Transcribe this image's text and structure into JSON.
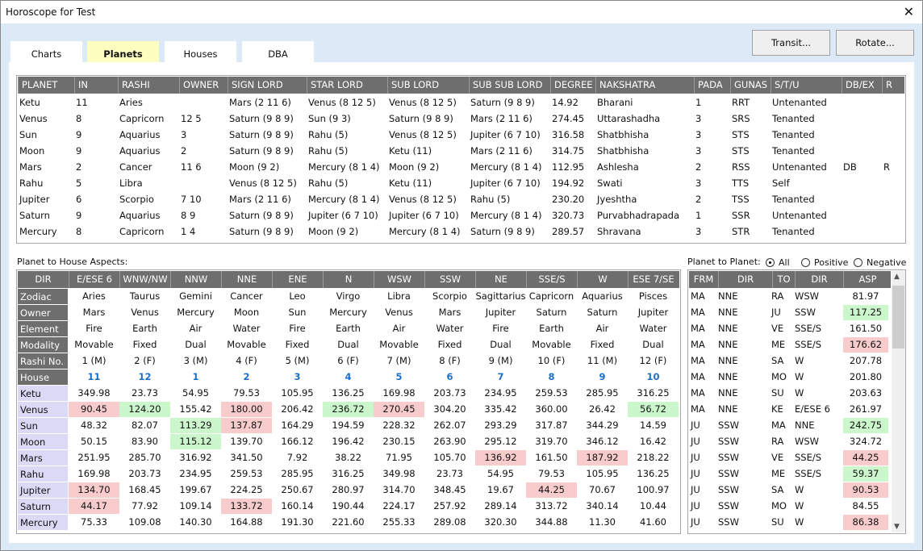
{
  "window": {
    "title": "Horoscope for Test"
  },
  "tabs": [
    {
      "label": "Charts"
    },
    {
      "label": "Planets",
      "active": true
    },
    {
      "label": "Houses"
    },
    {
      "label": "DBA"
    }
  ],
  "buttons": {
    "transit": "Transit...",
    "rotate": "Rotate..."
  },
  "colors": {
    "header": "#6e6e6e",
    "negative": "#f8cccc",
    "positive": "#ccf7cc",
    "planet_label": "#dcd9f6",
    "house_number": "#1c6fc4",
    "active_tab": "#fefec0"
  },
  "planets_table": {
    "columns": [
      "PLANET",
      "IN",
      "RASHI",
      "OWNER",
      "SIGN LORD",
      "STAR LORD",
      "SUB LORD",
      "SUB SUB LORD",
      "DEGREE",
      "NAKSHATRA",
      "PADA",
      "GUNAS",
      "S/T/U",
      "DB/EX",
      "R"
    ],
    "rows": [
      [
        "Ketu",
        "11",
        "Aries",
        "",
        "Mars (2 11 6)",
        "Venus (8 12 5)",
        "Venus (8 12 5)",
        "Saturn (9 8 9)",
        "14.92",
        "Bharani",
        "1",
        "RRT",
        "Untenanted",
        "",
        ""
      ],
      [
        "Venus",
        "8",
        "Capricorn",
        "12 5",
        "Saturn (9 8 9)",
        "Sun (9 3)",
        "Saturn (9 8 9)",
        "Mars (2 11 6)",
        "274.45",
        "Uttarashadha",
        "3",
        "SRS",
        "Tenanted",
        "",
        ""
      ],
      [
        "Sun",
        "9",
        "Aquarius",
        "3",
        "Saturn (9 8 9)",
        "Rahu (5)",
        "Venus (8 12 5)",
        "Jupiter (6 7 10)",
        "316.58",
        "Shatbhisha",
        "3",
        "STS",
        "Tenanted",
        "",
        ""
      ],
      [
        "Moon",
        "9",
        "Aquarius",
        "2",
        "Saturn (9 8 9)",
        "Rahu (5)",
        "Ketu (11)",
        "Mars (2 11 6)",
        "314.75",
        "Shatbhisha",
        "3",
        "STS",
        "Tenanted",
        "",
        ""
      ],
      [
        "Mars",
        "2",
        "Cancer",
        "11 6",
        "Moon (9 2)",
        "Mercury (8 1 4)",
        "Moon (9 2)",
        "Mercury (8 1 4)",
        "112.95",
        "Ashlesha",
        "2",
        "RSS",
        "Untenanted",
        "DB",
        "R"
      ],
      [
        "Rahu",
        "5",
        "Libra",
        "",
        "Venus (8 12 5)",
        "Rahu (5)",
        "Ketu (11)",
        "Jupiter (6 7 10)",
        "194.92",
        "Swati",
        "3",
        "TTS",
        "Self",
        "",
        ""
      ],
      [
        "Jupiter",
        "6",
        "Scorpio",
        "7 10",
        "Mars (2 11 6)",
        "Mercury (8 1 4)",
        "Venus (8 12 5)",
        "Rahu (5)",
        "230.20",
        "Jyeshtha",
        "2",
        "TSS",
        "Tenanted",
        "",
        ""
      ],
      [
        "Saturn",
        "9",
        "Aquarius",
        "8 9",
        "Saturn (9 8 9)",
        "Jupiter (6 7 10)",
        "Jupiter (6 7 10)",
        "Mercury (8 1 4)",
        "320.73",
        "Purvabhadrapada",
        "1",
        "SSR",
        "Untenanted",
        "",
        ""
      ],
      [
        "Mercury",
        "8",
        "Capricorn",
        "1 4",
        "Saturn (9 8 9)",
        "Moon (9 2)",
        "Mercury (8 1 4)",
        "Saturn (9 8 9)",
        "289.57",
        "Shravana",
        "3",
        "STR",
        "Tenanted",
        "",
        ""
      ]
    ]
  },
  "house_aspects": {
    "label": "Planet to House Aspects:",
    "corner": "DIR",
    "directions": [
      "E/ESE 6",
      "WNW/NW",
      "NNW",
      "NNE",
      "ENE",
      "N",
      "WSW",
      "SSW",
      "NE",
      "SSE/S",
      "W",
      "ESE 7/SE"
    ],
    "info_rows": [
      {
        "label": "Zodiac",
        "values": [
          "Aries",
          "Taurus",
          "Gemini",
          "Cancer",
          "Leo",
          "Virgo",
          "Libra",
          "Scorpio",
          "Sagittarius",
          "Capricorn",
          "Aquarius",
          "Pisces"
        ]
      },
      {
        "label": "Owner",
        "values": [
          "Mars",
          "Venus",
          "Mercury",
          "Moon",
          "Sun",
          "Mercury",
          "Venus",
          "Mars",
          "Jupiter",
          "Saturn",
          "Saturn",
          "Jupiter"
        ]
      },
      {
        "label": "Element",
        "values": [
          "Fire",
          "Earth",
          "Air",
          "Water",
          "Fire",
          "Earth",
          "Air",
          "Water",
          "Fire",
          "Earth",
          "Air",
          "Water"
        ]
      },
      {
        "label": "Modality",
        "values": [
          "Movable",
          "Fixed",
          "Dual",
          "Movable",
          "Fixed",
          "Dual",
          "Movable",
          "Fixed",
          "Dual",
          "Movable",
          "Fixed",
          "Dual"
        ]
      },
      {
        "label": "Rashi No.",
        "values": [
          "1 (M)",
          "2 (F)",
          "3 (M)",
          "4 (F)",
          "5 (M)",
          "6 (F)",
          "7 (M)",
          "8 (F)",
          "9 (M)",
          "10 (F)",
          "11 (M)",
          "12 (F)"
        ]
      },
      {
        "label": "House",
        "values": [
          "11",
          "12",
          "1",
          "2",
          "3",
          "4",
          "5",
          "6",
          "7",
          "8",
          "9",
          "10"
        ],
        "house": true
      }
    ],
    "planet_rows": [
      {
        "label": "Ketu",
        "values": [
          "349.98",
          "23.73",
          "54.95",
          "79.53",
          "105.95",
          "136.25",
          "169.98",
          "203.73",
          "234.95",
          "259.53",
          "285.95",
          "316.25"
        ],
        "marks": [
          "",
          "",
          "",
          "",
          "",
          "",
          "",
          "",
          "",
          "",
          "",
          ""
        ]
      },
      {
        "label": "Venus",
        "values": [
          "90.45",
          "124.20",
          "155.42",
          "180.00",
          "206.42",
          "236.72",
          "270.45",
          "304.20",
          "335.42",
          "360.00",
          "26.42",
          "56.72"
        ],
        "marks": [
          "neg",
          "pos",
          "",
          "neg",
          "",
          "pos",
          "neg",
          "",
          "",
          "",
          "",
          "pos"
        ]
      },
      {
        "label": "Sun",
        "values": [
          "48.32",
          "82.07",
          "113.29",
          "137.87",
          "164.29",
          "194.59",
          "228.32",
          "262.07",
          "293.29",
          "317.87",
          "344.29",
          "14.59"
        ],
        "marks": [
          "",
          "",
          "pos",
          "neg",
          "",
          "",
          "",
          "",
          "",
          "",
          "",
          ""
        ]
      },
      {
        "label": "Moon",
        "values": [
          "50.15",
          "83.90",
          "115.12",
          "139.70",
          "166.12",
          "196.42",
          "230.15",
          "263.90",
          "295.12",
          "319.70",
          "346.12",
          "16.42"
        ],
        "marks": [
          "",
          "",
          "pos",
          "",
          "",
          "",
          "",
          "",
          "",
          "",
          "",
          ""
        ]
      },
      {
        "label": "Mars",
        "values": [
          "251.95",
          "285.70",
          "316.92",
          "341.50",
          "7.92",
          "38.22",
          "71.95",
          "105.70",
          "136.92",
          "161.50",
          "187.92",
          "218.22"
        ],
        "marks": [
          "",
          "",
          "",
          "",
          "",
          "",
          "",
          "",
          "neg",
          "",
          "neg",
          ""
        ]
      },
      {
        "label": "Rahu",
        "values": [
          "169.98",
          "203.73",
          "234.95",
          "259.53",
          "285.95",
          "316.25",
          "349.98",
          "23.73",
          "54.95",
          "79.53",
          "105.95",
          "136.25"
        ],
        "marks": [
          "",
          "",
          "",
          "",
          "",
          "",
          "",
          "",
          "",
          "",
          "",
          ""
        ]
      },
      {
        "label": "Jupiter",
        "values": [
          "134.70",
          "168.45",
          "199.67",
          "224.25",
          "250.67",
          "280.97",
          "314.70",
          "348.45",
          "19.67",
          "44.25",
          "70.67",
          "100.97"
        ],
        "marks": [
          "neg",
          "",
          "",
          "",
          "",
          "",
          "",
          "",
          "",
          "neg",
          "",
          ""
        ]
      },
      {
        "label": "Saturn",
        "values": [
          "44.17",
          "77.92",
          "109.14",
          "133.72",
          "160.14",
          "190.44",
          "224.17",
          "257.92",
          "289.14",
          "313.72",
          "340.14",
          "10.44"
        ],
        "marks": [
          "neg",
          "",
          "",
          "neg",
          "",
          "",
          "",
          "",
          "",
          "",
          "",
          ""
        ]
      },
      {
        "label": "Mercury",
        "values": [
          "75.33",
          "109.08",
          "140.30",
          "164.88",
          "191.30",
          "221.60",
          "255.33",
          "289.08",
          "320.30",
          "344.88",
          "11.30",
          "41.60"
        ],
        "marks": [
          "",
          "",
          "",
          "",
          "",
          "",
          "",
          "",
          "",
          "",
          "",
          ""
        ]
      }
    ]
  },
  "planet_to_planet": {
    "label": "Planet to Planet:",
    "filters": [
      {
        "label": "All",
        "selected": true
      },
      {
        "label": "Positive",
        "selected": false
      },
      {
        "label": "Negative",
        "selected": false
      }
    ],
    "columns": [
      "FRM",
      "DIR",
      "TO",
      "DIR",
      "ASP"
    ],
    "rows": [
      [
        "MA",
        "NNE",
        "RA",
        "WSW",
        "81.97",
        ""
      ],
      [
        "MA",
        "NNE",
        "JU",
        "SSW",
        "117.25",
        "pos"
      ],
      [
        "MA",
        "NNE",
        "VE",
        "SSE/S",
        "161.50",
        ""
      ],
      [
        "MA",
        "NNE",
        "ME",
        "SSE/S",
        "176.62",
        "neg"
      ],
      [
        "MA",
        "NNE",
        "SA",
        "W",
        "207.78",
        ""
      ],
      [
        "MA",
        "NNE",
        "MO",
        "W",
        "201.80",
        ""
      ],
      [
        "MA",
        "NNE",
        "SU",
        "W",
        "203.63",
        ""
      ],
      [
        "MA",
        "NNE",
        "KE",
        "E/ESE 6",
        "261.97",
        ""
      ],
      [
        "JU",
        "SSW",
        "MA",
        "NNE",
        "242.75",
        "pos"
      ],
      [
        "JU",
        "SSW",
        "RA",
        "WSW",
        "324.72",
        ""
      ],
      [
        "JU",
        "SSW",
        "VE",
        "SSE/S",
        "44.25",
        "neg"
      ],
      [
        "JU",
        "SSW",
        "ME",
        "SSE/S",
        "59.37",
        "pos"
      ],
      [
        "JU",
        "SSW",
        "SA",
        "W",
        "90.53",
        "neg"
      ],
      [
        "JU",
        "SSW",
        "MO",
        "W",
        "84.55",
        ""
      ],
      [
        "JU",
        "SSW",
        "SU",
        "W",
        "86.38",
        "neg"
      ]
    ]
  }
}
